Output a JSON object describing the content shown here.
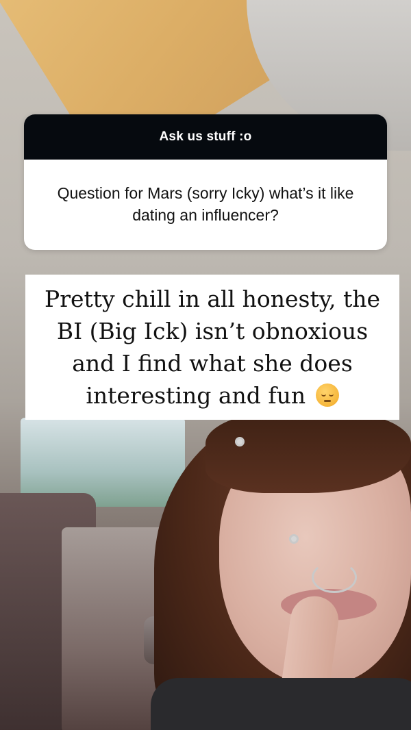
{
  "story": {
    "question_sticker": {
      "header": "Ask us stuff :o",
      "question": "Question for Mars (sorry Icky) what’s it like dating an influencer?"
    },
    "answer": {
      "text": "Pretty chill in all honesty, the BI (Big Ick) isn’t obnoxious and I find what she does interesting and fun",
      "emoji_icon": "pensive-face-icon"
    }
  },
  "colors": {
    "sticker_header_bg": "#060a0f",
    "sticker_body_bg": "#ffffff",
    "text": "#111111"
  }
}
